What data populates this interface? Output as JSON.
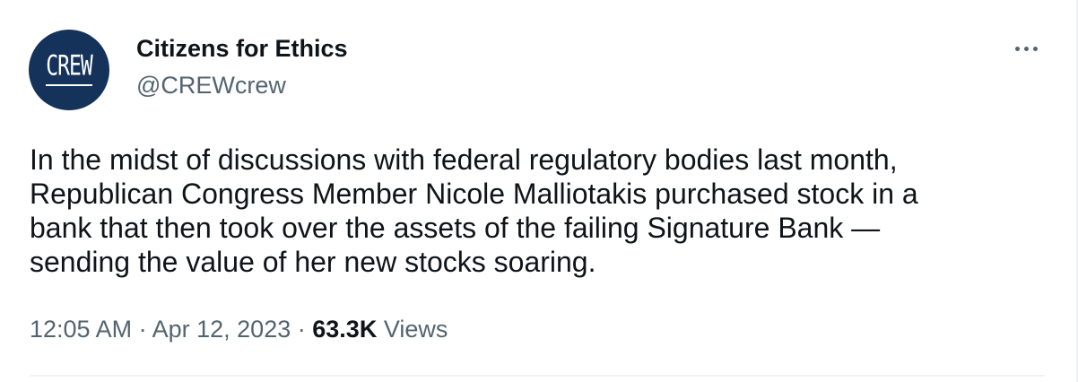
{
  "author": {
    "display_name": "Citizens for Ethics",
    "handle": "@CREWcrew",
    "avatar_text": "CREW",
    "avatar_color": "#14325a"
  },
  "tweet": {
    "text": "In the midst of discussions with federal regulatory bodies last month,\nRepublican Congress Member Nicole Malliotakis purchased stock in a\nbank that then took over the assets of the failing Signature Bank —\nsending the value of her new stocks soaring.",
    "time": "12:05 AM",
    "separator": "·",
    "date": "Apr 12, 2023",
    "views_count": "63.3K",
    "views_label": "Views"
  },
  "icons": {
    "more": "more-horizontal-icon"
  },
  "colors": {
    "text_primary": "#0f1419",
    "text_secondary": "#536471",
    "divider": "#eff3f4"
  }
}
